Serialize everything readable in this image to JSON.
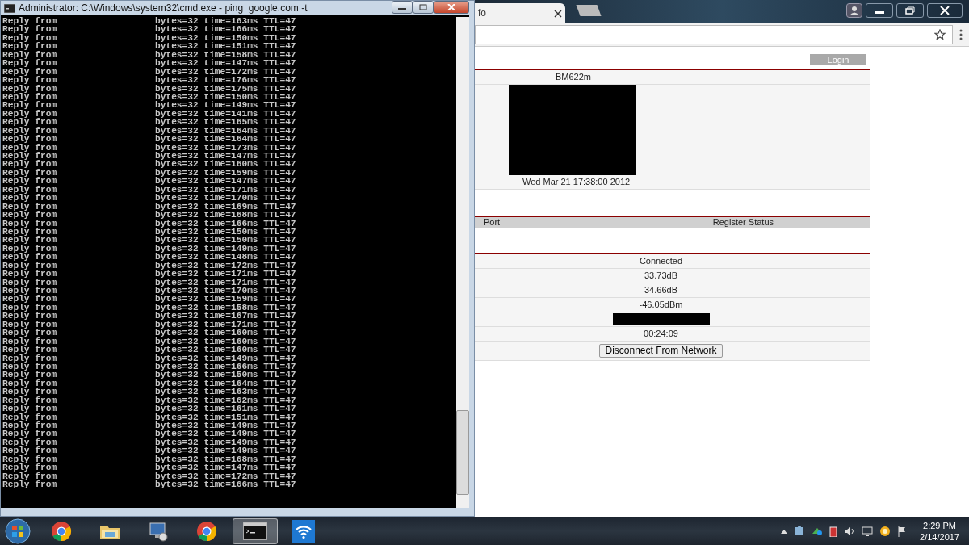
{
  "cmd_window": {
    "title": "Administrator: C:\\Windows\\system32\\cmd.exe - ping  google.com -t",
    "lines": [
      {
        "prefix": "Reply from",
        "stats": "bytes=32 time=163ms TTL=47"
      },
      {
        "prefix": "Reply from",
        "stats": "bytes=32 time=166ms TTL=47"
      },
      {
        "prefix": "Reply from",
        "stats": "bytes=32 time=150ms TTL=47"
      },
      {
        "prefix": "Reply from",
        "stats": "bytes=32 time=151ms TTL=47"
      },
      {
        "prefix": "Reply from",
        "stats": "bytes=32 time=158ms TTL=47"
      },
      {
        "prefix": "Reply from",
        "stats": "bytes=32 time=147ms TTL=47"
      },
      {
        "prefix": "Reply from",
        "stats": "bytes=32 time=172ms TTL=47"
      },
      {
        "prefix": "Reply from",
        "stats": "bytes=32 time=176ms TTL=47"
      },
      {
        "prefix": "Reply from",
        "stats": "bytes=32 time=175ms TTL=47"
      },
      {
        "prefix": "Reply from",
        "stats": "bytes=32 time=150ms TTL=47"
      },
      {
        "prefix": "Reply from",
        "stats": "bytes=32 time=149ms TTL=47"
      },
      {
        "prefix": "Reply from",
        "stats": "bytes=32 time=141ms TTL=47"
      },
      {
        "prefix": "Reply from",
        "stats": "bytes=32 time=165ms TTL=47"
      },
      {
        "prefix": "Reply from",
        "stats": "bytes=32 time=164ms TTL=47"
      },
      {
        "prefix": "Reply from",
        "stats": "bytes=32 time=164ms TTL=47"
      },
      {
        "prefix": "Reply from",
        "stats": "bytes=32 time=173ms TTL=47"
      },
      {
        "prefix": "Reply from",
        "stats": "bytes=32 time=147ms TTL=47"
      },
      {
        "prefix": "Reply from",
        "stats": "bytes=32 time=160ms TTL=47"
      },
      {
        "prefix": "Reply from",
        "stats": "bytes=32 time=159ms TTL=47"
      },
      {
        "prefix": "Reply from",
        "stats": "bytes=32 time=147ms TTL=47"
      },
      {
        "prefix": "Reply from",
        "stats": "bytes=32 time=171ms TTL=47"
      },
      {
        "prefix": "Reply from",
        "stats": "bytes=32 time=170ms TTL=47"
      },
      {
        "prefix": "Reply from",
        "stats": "bytes=32 time=169ms TTL=47"
      },
      {
        "prefix": "Reply from",
        "stats": "bytes=32 time=168ms TTL=47"
      },
      {
        "prefix": "Reply from",
        "stats": "bytes=32 time=166ms TTL=47"
      },
      {
        "prefix": "Reply from",
        "stats": "bytes=32 time=150ms TTL=47"
      },
      {
        "prefix": "Reply from",
        "stats": "bytes=32 time=150ms TTL=47"
      },
      {
        "prefix": "Reply from",
        "stats": "bytes=32 time=149ms TTL=47"
      },
      {
        "prefix": "Reply from",
        "stats": "bytes=32 time=148ms TTL=47"
      },
      {
        "prefix": "Reply from",
        "stats": "bytes=32 time=172ms TTL=47"
      },
      {
        "prefix": "Reply from",
        "stats": "bytes=32 time=171ms TTL=47"
      },
      {
        "prefix": "Reply from",
        "stats": "bytes=32 time=171ms TTL=47"
      },
      {
        "prefix": "Reply from",
        "stats": "bytes=32 time=170ms TTL=47"
      },
      {
        "prefix": "Reply from",
        "stats": "bytes=32 time=159ms TTL=47"
      },
      {
        "prefix": "Reply from",
        "stats": "bytes=32 time=158ms TTL=47"
      },
      {
        "prefix": "Reply from",
        "stats": "bytes=32 time=167ms TTL=47"
      },
      {
        "prefix": "Reply from",
        "stats": "bytes=32 time=171ms TTL=47"
      },
      {
        "prefix": "Reply from",
        "stats": "bytes=32 time=160ms TTL=47"
      },
      {
        "prefix": "Reply from",
        "stats": "bytes=32 time=160ms TTL=47"
      },
      {
        "prefix": "Reply from",
        "stats": "bytes=32 time=160ms TTL=47"
      },
      {
        "prefix": "Reply from",
        "stats": "bytes=32 time=149ms TTL=47"
      },
      {
        "prefix": "Reply from",
        "stats": "bytes=32 time=166ms TTL=47"
      },
      {
        "prefix": "Reply from",
        "stats": "bytes=32 time=150ms TTL=47"
      },
      {
        "prefix": "Reply from",
        "stats": "bytes=32 time=164ms TTL=47"
      },
      {
        "prefix": "Reply from",
        "stats": "bytes=32 time=163ms TTL=47"
      },
      {
        "prefix": "Reply from",
        "stats": "bytes=32 time=162ms TTL=47"
      },
      {
        "prefix": "Reply from",
        "stats": "bytes=32 time=161ms TTL=47"
      },
      {
        "prefix": "Reply from",
        "stats": "bytes=32 time=151ms TTL=47"
      },
      {
        "prefix": "Reply from",
        "stats": "bytes=32 time=149ms TTL=47"
      },
      {
        "prefix": "Reply from",
        "stats": "bytes=32 time=149ms TTL=47"
      },
      {
        "prefix": "Reply from",
        "stats": "bytes=32 time=149ms TTL=47"
      },
      {
        "prefix": "Reply from",
        "stats": "bytes=32 time=149ms TTL=47"
      },
      {
        "prefix": "Reply from",
        "stats": "bytes=32 time=168ms TTL=47"
      },
      {
        "prefix": "Reply from",
        "stats": "bytes=32 time=147ms TTL=47"
      },
      {
        "prefix": "Reply from",
        "stats": "bytes=32 time=172ms TTL=47"
      },
      {
        "prefix": "Reply from",
        "stats": "bytes=32 time=166ms TTL=47"
      }
    ]
  },
  "browser": {
    "tab": {
      "title": "fo",
      "selected": true
    },
    "login_button": "Login",
    "device_section": {
      "model": "BM622m",
      "date": "Wed Mar 21 17:38:00 2012"
    },
    "ports_section": {
      "columns": [
        "Port",
        "Register Status"
      ]
    },
    "connection_section": {
      "rows": [
        {
          "kind": "text",
          "value": "Connected"
        },
        {
          "kind": "text",
          "value": "33.73dB"
        },
        {
          "kind": "text",
          "value": "34.66dB"
        },
        {
          "kind": "text",
          "value": "-46.05dBm"
        },
        {
          "kind": "redacted"
        },
        {
          "kind": "text",
          "value": "00:24:09"
        },
        {
          "kind": "button",
          "label": "Disconnect From Network"
        }
      ]
    }
  },
  "taskbar": {
    "apps": [
      {
        "kind": "browser",
        "selected": false
      },
      {
        "kind": "folder",
        "selected": false
      },
      {
        "kind": "computer",
        "selected": false
      },
      {
        "kind": "browser",
        "selected": false
      },
      {
        "kind": "terminal",
        "selected": true
      },
      {
        "kind": "wifi",
        "selected": false
      }
    ],
    "clock": {
      "time": "2:29 PM",
      "date": "2/14/2017"
    }
  }
}
